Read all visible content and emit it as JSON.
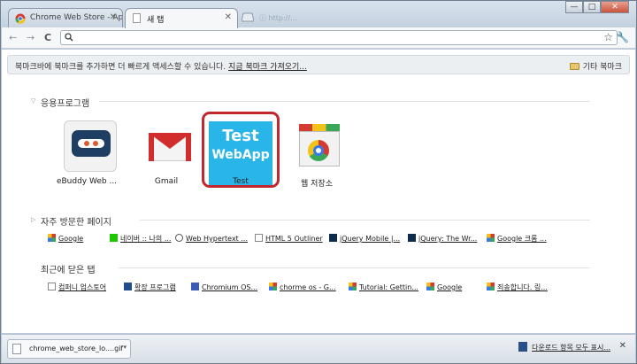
{
  "tabs": [
    {
      "title": "Chrome Web Store - Ap",
      "close": "✕"
    },
    {
      "title": "새 탭",
      "close": "✕"
    }
  ],
  "ghost_tab_text": "ⓘ http://...",
  "window_controls": {
    "minimize": "—",
    "maximize": "□",
    "close": "✕"
  },
  "toolbar": {
    "back": "←",
    "forward": "→",
    "reload": "C",
    "omnibox_value": "",
    "star": "☆",
    "wrench": "🔧"
  },
  "bookmark_bar": {
    "message": "북마크바에 북마크를 추가하면 더 빠르게 액세스할 수 있습니다.",
    "import_link": "지금 북마크 가져오기...",
    "other_bookmarks": "기타 북마크"
  },
  "apps_section": {
    "title": "응용프로그램",
    "apps": [
      {
        "label": "eBuddy Web ..."
      },
      {
        "label": "Gmail"
      },
      {
        "label": "Test",
        "tile_line1": "Test",
        "tile_line2": "WebApp"
      },
      {
        "label": "웹 저장소"
      }
    ]
  },
  "most_visited": {
    "title": "자주 방문한 페이지",
    "items": [
      {
        "label": "Google",
        "icon": "google-icon"
      },
      {
        "label": "네이버 :: 나의 ...",
        "icon": "naver-icon"
      },
      {
        "label": "Web Hypertext ...",
        "icon": "whatwg-icon"
      },
      {
        "label": "HTML 5 Outliner",
        "icon": "page-icon"
      },
      {
        "label": "jQuery Mobile |...",
        "icon": "jquery-icon"
      },
      {
        "label": "jQuery: The Wr...",
        "icon": "jquery-icon"
      },
      {
        "label": "Google 크롬 ...",
        "icon": "google-icon"
      }
    ]
  },
  "recently_closed": {
    "title": "최근에 닫은 탭",
    "items": [
      {
        "label": "컴퍼니 업스토어",
        "icon": "page-icon"
      },
      {
        "label": "확장 프로그램",
        "icon": "puzzle-icon"
      },
      {
        "label": "Chromium OS...",
        "icon": "chromium-icon"
      },
      {
        "label": "chorme os - G...",
        "icon": "google-icon"
      },
      {
        "label": "Tutorial: Gettin...",
        "icon": "google-icon"
      },
      {
        "label": "Google",
        "icon": "google-icon"
      },
      {
        "label": "죄송합니다. 링...",
        "icon": "google-icon"
      }
    ]
  },
  "download_shelf": {
    "file_name": "chrome_web_store_lo....gif",
    "menu_arrow": "▾",
    "show_all": "다운로드 항목 모두 표시...",
    "close": "✕"
  }
}
